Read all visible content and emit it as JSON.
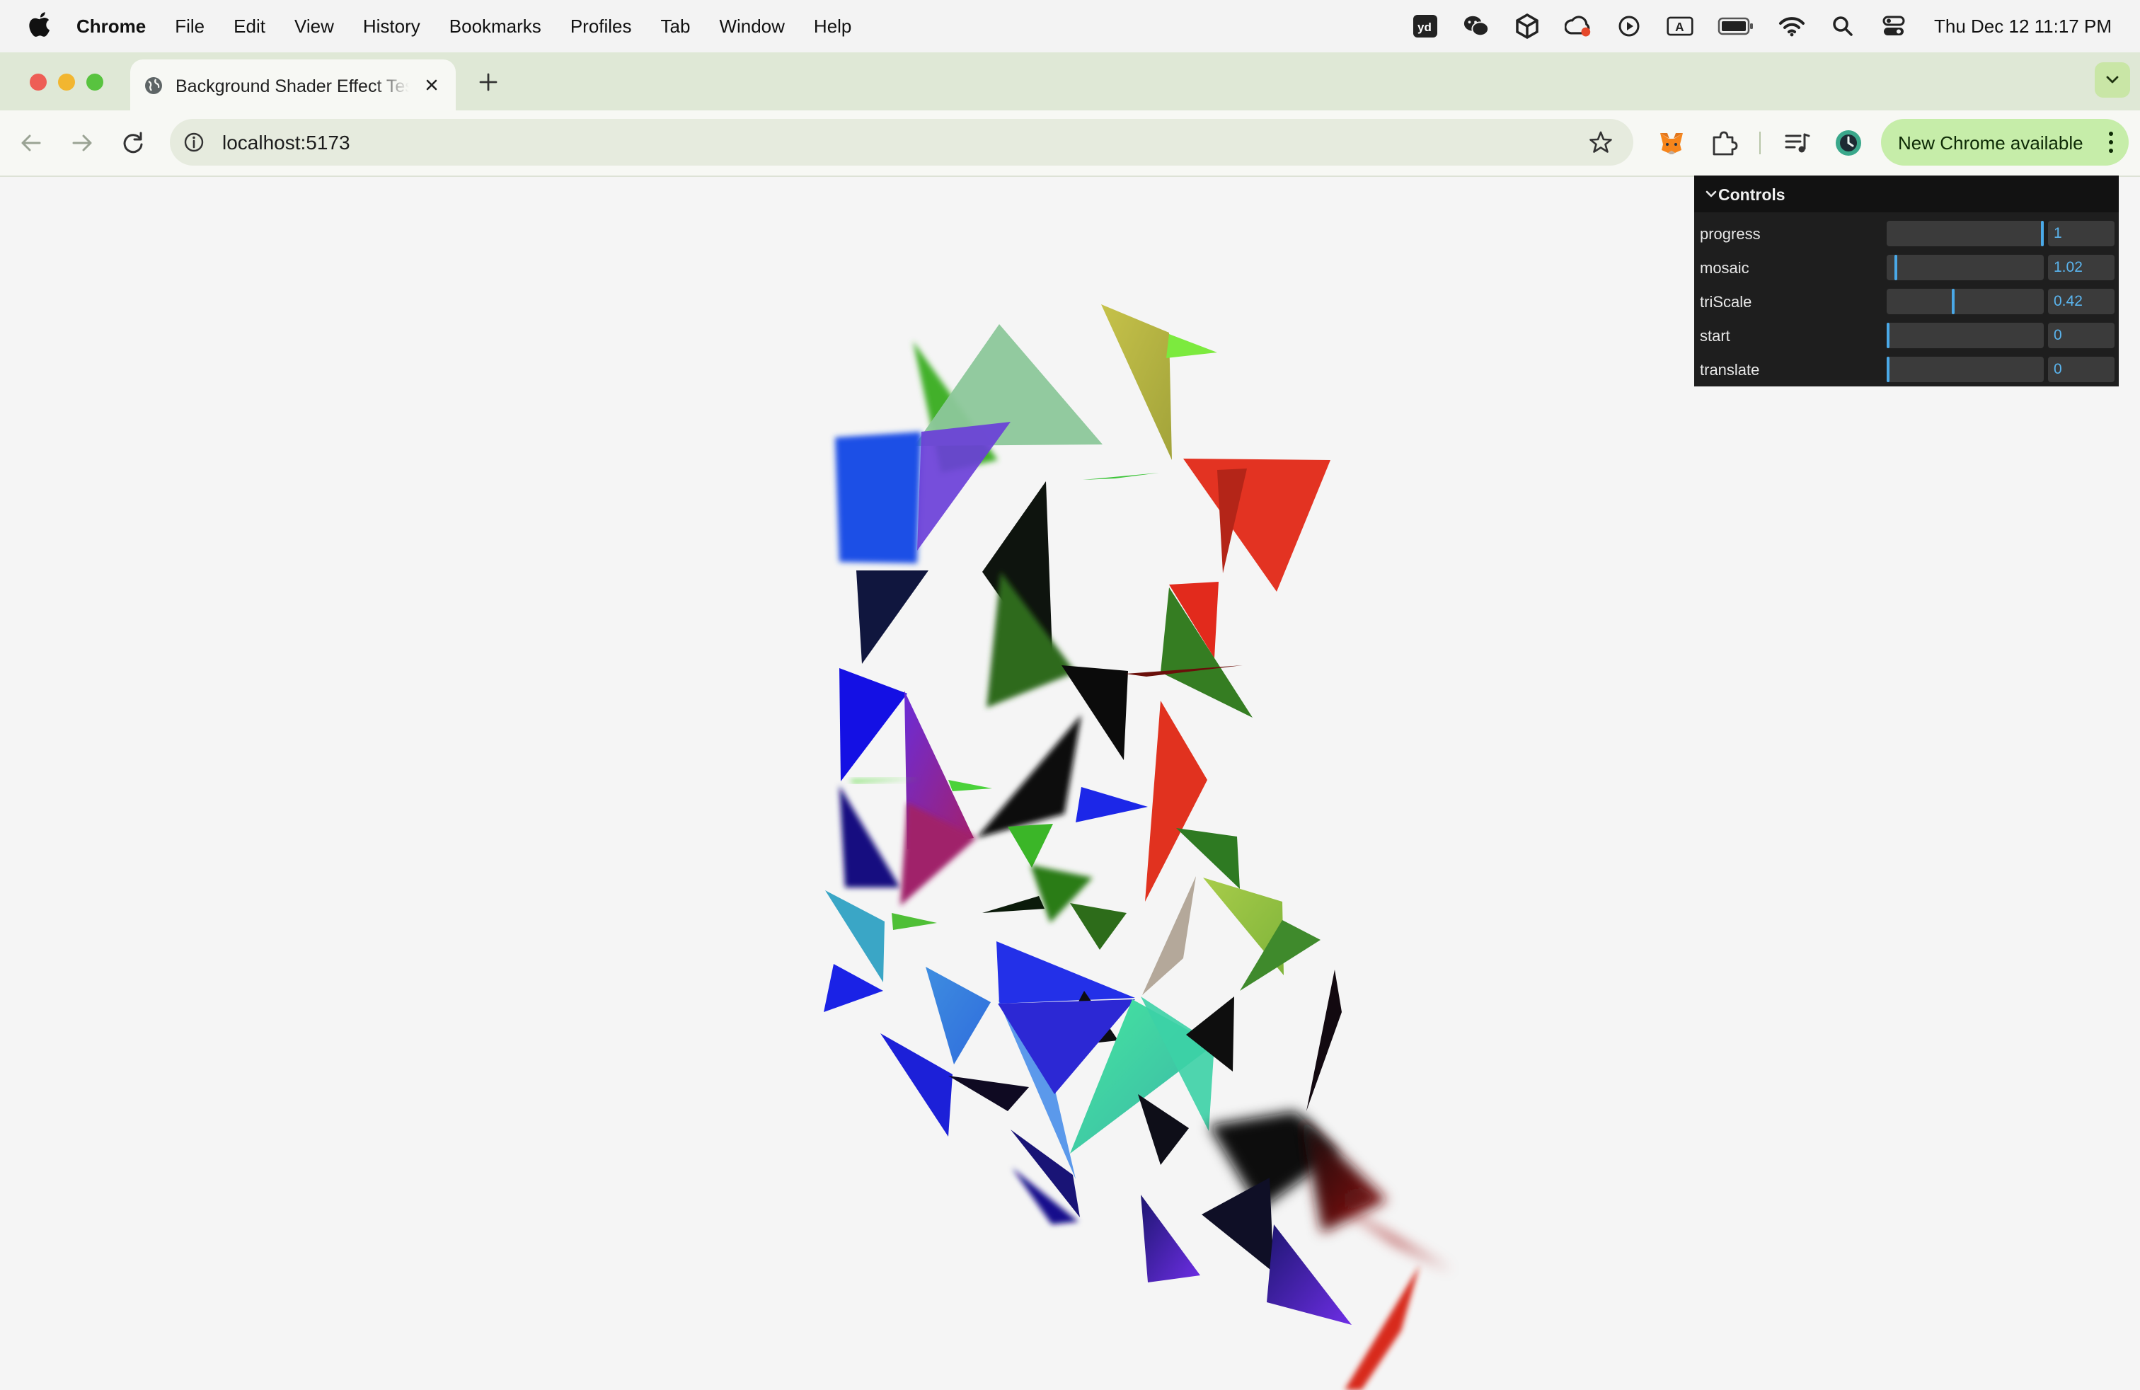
{
  "menubar": {
    "app_name": "Chrome",
    "menus": [
      "File",
      "Edit",
      "View",
      "History",
      "Bookmarks",
      "Profiles",
      "Tab",
      "Window",
      "Help"
    ],
    "clock": "Thu Dec 12  11:17 PM",
    "status_icons": [
      "youdao-icon",
      "wechat-icon",
      "unity-icon",
      "creative-cloud-icon",
      "play-icon",
      "input-source-icon",
      "battery-icon",
      "wifi-icon",
      "spotlight-icon",
      "control-center-icon"
    ]
  },
  "browser": {
    "tab_title": "Background Shader Effect Test",
    "url": "localhost:5173",
    "update_label": "New Chrome available",
    "accent": "#c6eda9"
  },
  "controls": {
    "title": "Controls",
    "rows": [
      {
        "label": "progress",
        "value": "1",
        "fraction": 1.0
      },
      {
        "label": "mosaic",
        "value": "1.02",
        "fraction": 0.05
      },
      {
        "label": "triScale",
        "value": "0.42",
        "fraction": 0.42
      },
      {
        "label": "start",
        "value": "0",
        "fraction": 0.0
      },
      {
        "label": "translate",
        "value": "0",
        "fraction": 0.0
      }
    ],
    "accent": "#4aa9e8"
  }
}
